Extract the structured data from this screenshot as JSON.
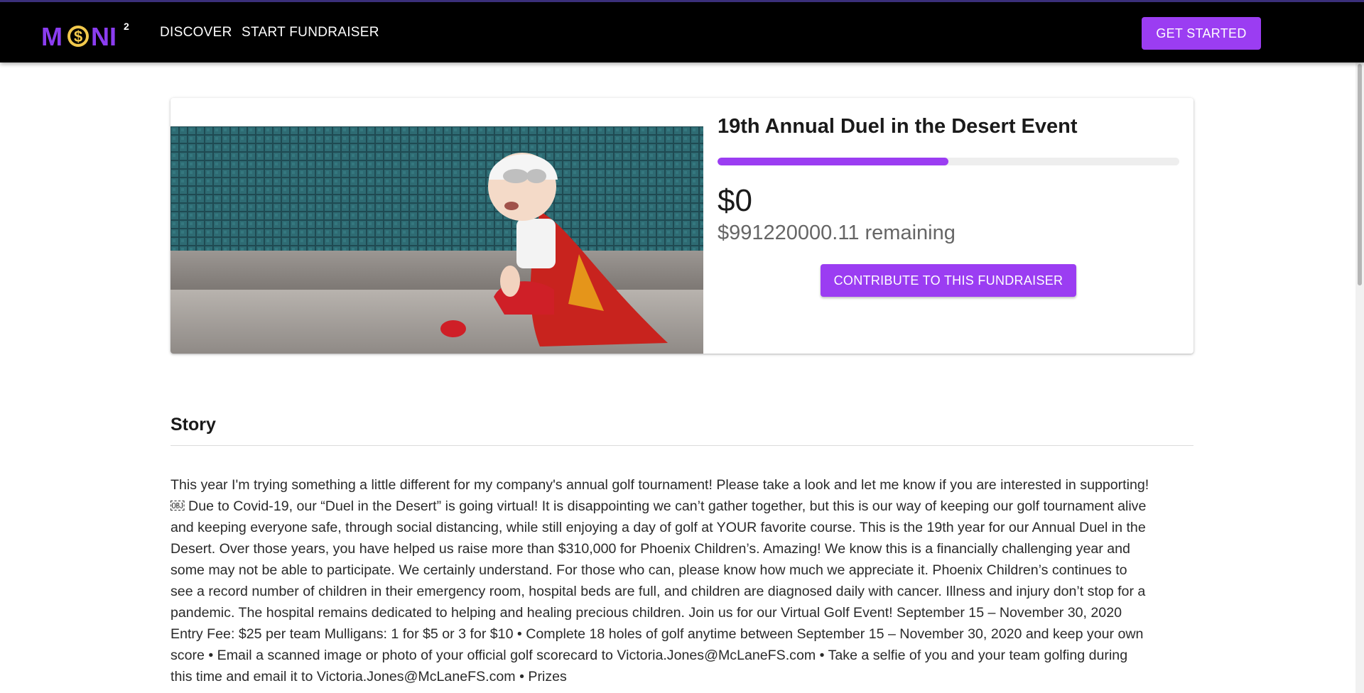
{
  "header": {
    "logo_text": "MONI",
    "logo_superscript": "2",
    "nav": [
      {
        "label": "DISCOVER"
      },
      {
        "label": "START FUNDRAISER"
      }
    ],
    "cta_label": "GET STARTED"
  },
  "fundraiser": {
    "title": "19th Annual Duel in the Desert Event",
    "progress_percent": 50,
    "raised": "$0",
    "remaining": "$991220000.11 remaining",
    "contribute_label": "CONTRIBUTE TO THIS FUNDRAISER"
  },
  "story": {
    "heading": "Story",
    "body": "This year I'm trying something a little different for my company's annual golf tournament! Please take a look and let me know if you are interested in supporting! ￼ Due to Covid-19, our “Duel in the Desert” is going virtual! It is disappointing we can’t gather together, but this is our way of keeping our golf tournament alive and keeping everyone safe, through social distancing, while still enjoying a day of golf at YOUR favorite course. This is the 19th year for our Annual Duel in the Desert. Over those years, you have helped us raise more than $310,000 for Phoenix Children’s. Amazing! We know this is a financially challenging year and some may not be able to participate. We certainly understand. For those who can, please know how much we appreciate it. Phoenix Children’s continues to see a record number of children in their emergency room, hospital beds are full, and children are diagnosed daily with cancer. Illness and injury don’t stop for a pandemic. The hospital remains dedicated to helping and healing precious children. Join us for our Virtual Golf Event! September 15 – November 30, 2020 Entry Fee: $25 per team Mulligans: 1 for $5 or 3 for $10 • Complete 18 holes of golf anytime between September 15 – November 30, 2020 and keep your own score • Email a scanned image or photo of your official golf scorecard to Victoria.Jones@McLaneFS.com • Take a selfie of you and your team golfing during this time and email it to Victoria.Jones@McLaneFS.com • Prizes"
  },
  "colors": {
    "accent": "#9b3df2",
    "appbar": "#000000",
    "logo_gold": "#f2c94c",
    "logo_purple": "#8b3df0"
  }
}
